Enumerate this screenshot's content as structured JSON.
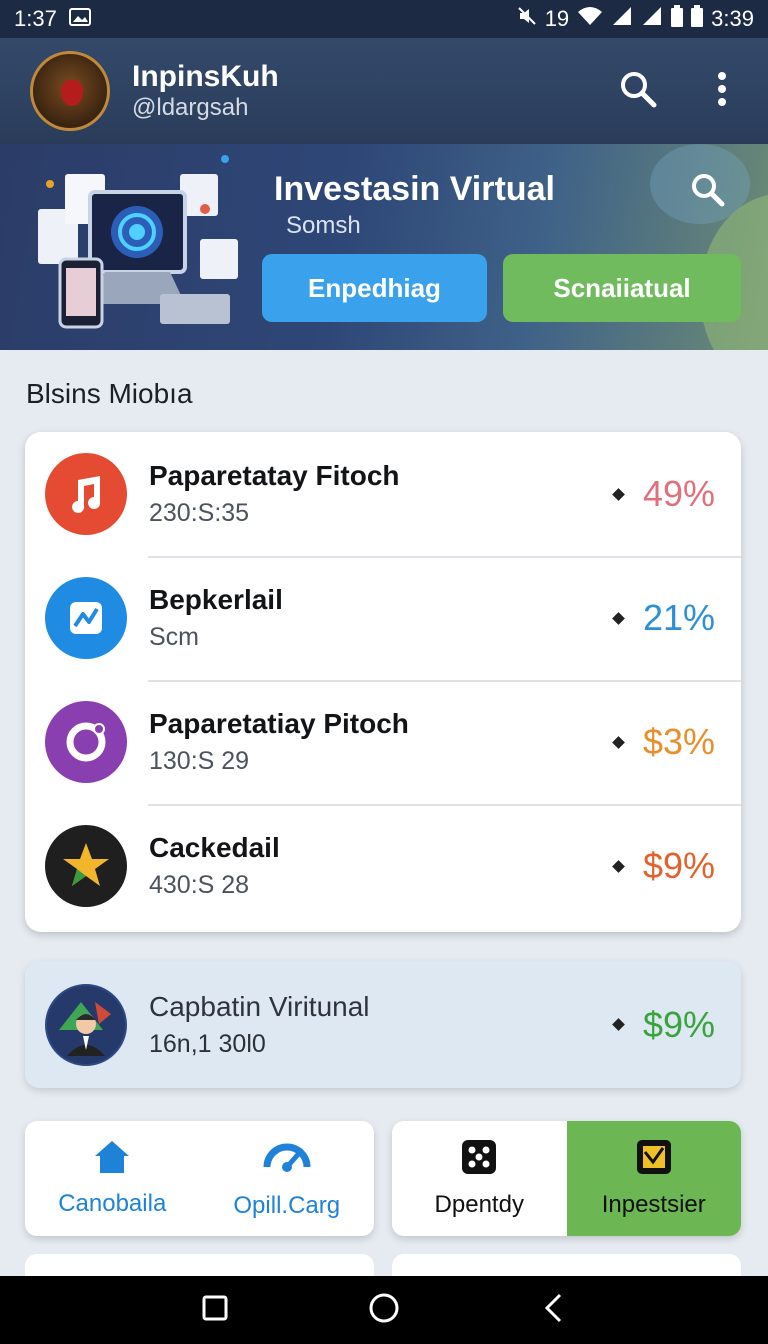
{
  "status_bar": {
    "time": "1:37",
    "signal_text": "19",
    "battery_time": "3:39"
  },
  "app_bar": {
    "title": "InpinsKuh",
    "handle": "@ldargsah"
  },
  "hero": {
    "title": "Investasin Virtual",
    "subtitle": "Somsh",
    "primary_button": "Enpedhiag",
    "secondary_button": "Scnaiiatual"
  },
  "section": {
    "title": "Blsins Miobıa"
  },
  "list": [
    {
      "name": "Paparetatay Fitoch",
      "meta": "230:S:35",
      "value": "49%",
      "color": "#e0707a",
      "icon": "music-note-icon",
      "icon_bg": "#e54a32"
    },
    {
      "name": "Bepkerlail",
      "meta": "Scm",
      "value": "21%",
      "color": "#2d8fd8",
      "icon": "chart-line-icon",
      "icon_bg": "#1f8be2"
    },
    {
      "name": "Paparetatiay Pitoch",
      "meta": "130:S 29",
      "value": "$3%",
      "color": "#e88e2c",
      "icon": "camera-ring-icon",
      "icon_bg": "#8a3fb1"
    },
    {
      "name": "Cackedail",
      "meta": "430:S 28",
      "value": "$9%",
      "color": "#e2622d",
      "icon": "star-icon",
      "icon_bg": "#1f1f1f"
    }
  ],
  "featured": {
    "name": "Capbatin Viritunal",
    "meta": "16n,1 30l0",
    "value": "$9%",
    "color": "#3aa33e",
    "icon": "person-avatar-icon"
  },
  "tiles_left": [
    {
      "label": "Canobaila",
      "icon": "home-icon"
    },
    {
      "label": "Opill.Carg",
      "icon": "gauge-icon"
    }
  ],
  "tiles_right": [
    {
      "label": "Dpentdy",
      "icon": "dice-icon"
    },
    {
      "label": "Inpestsier",
      "icon": "chart-tablet-icon"
    }
  ],
  "colors": {
    "accent_blue": "#3aa1ec",
    "accent_green": "#6fbb5d",
    "appbar": "#2f4364"
  }
}
